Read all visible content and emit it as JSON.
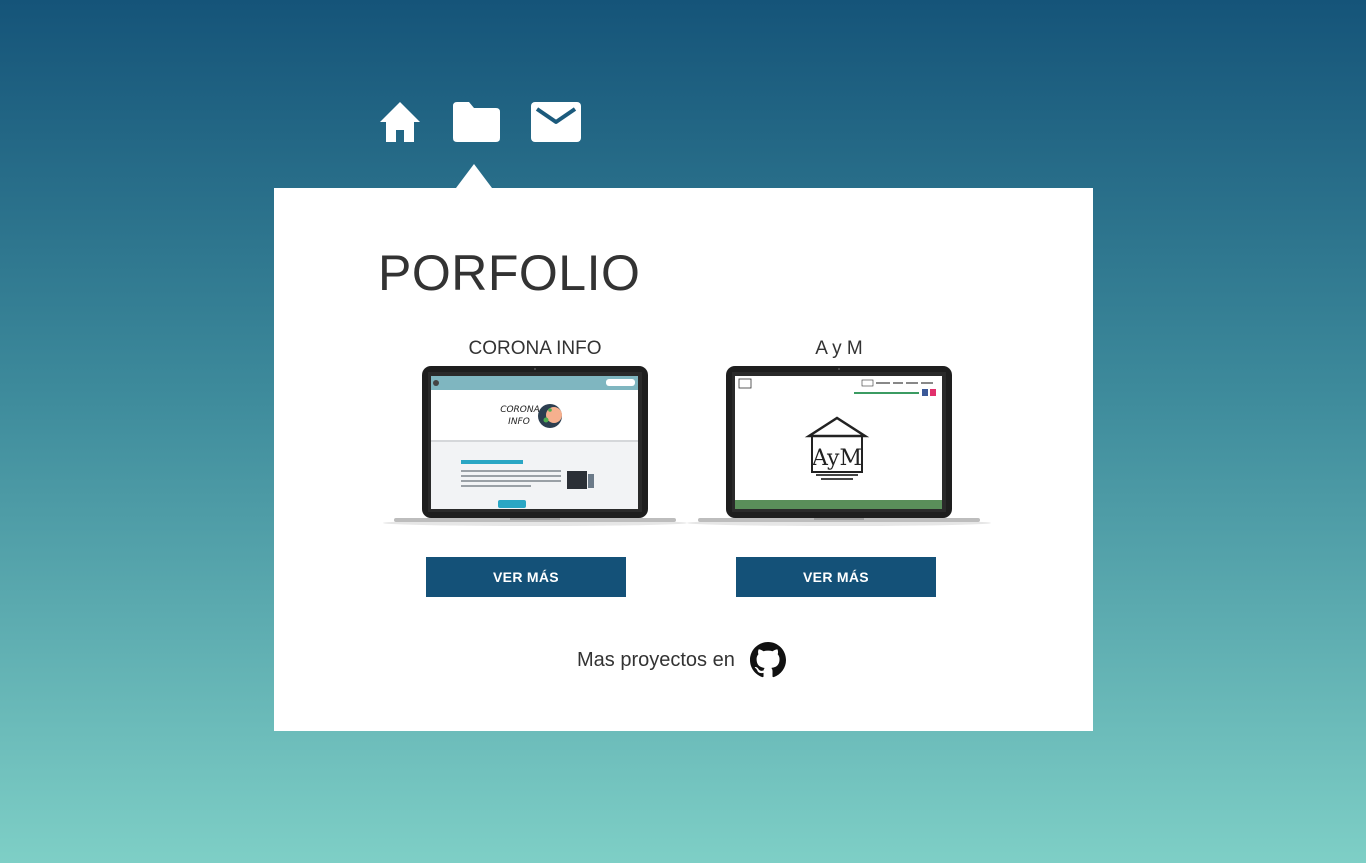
{
  "nav": {
    "items": [
      {
        "icon": "home-icon"
      },
      {
        "icon": "folder-icon",
        "active": true
      },
      {
        "icon": "mail-icon"
      }
    ]
  },
  "colors": {
    "bg_top": "#155479",
    "bg_bottom": "#7ecfc6",
    "button": "#145178",
    "text": "#333333"
  },
  "portfolio": {
    "title": "PORFOLIO",
    "projects": [
      {
        "name": "CORONA INFO",
        "button_label": "VER MÁS"
      },
      {
        "name": "A y M",
        "button_label": "VER MÁS"
      }
    ],
    "more_text": "Mas proyectos en",
    "more_icon": "github-icon"
  }
}
